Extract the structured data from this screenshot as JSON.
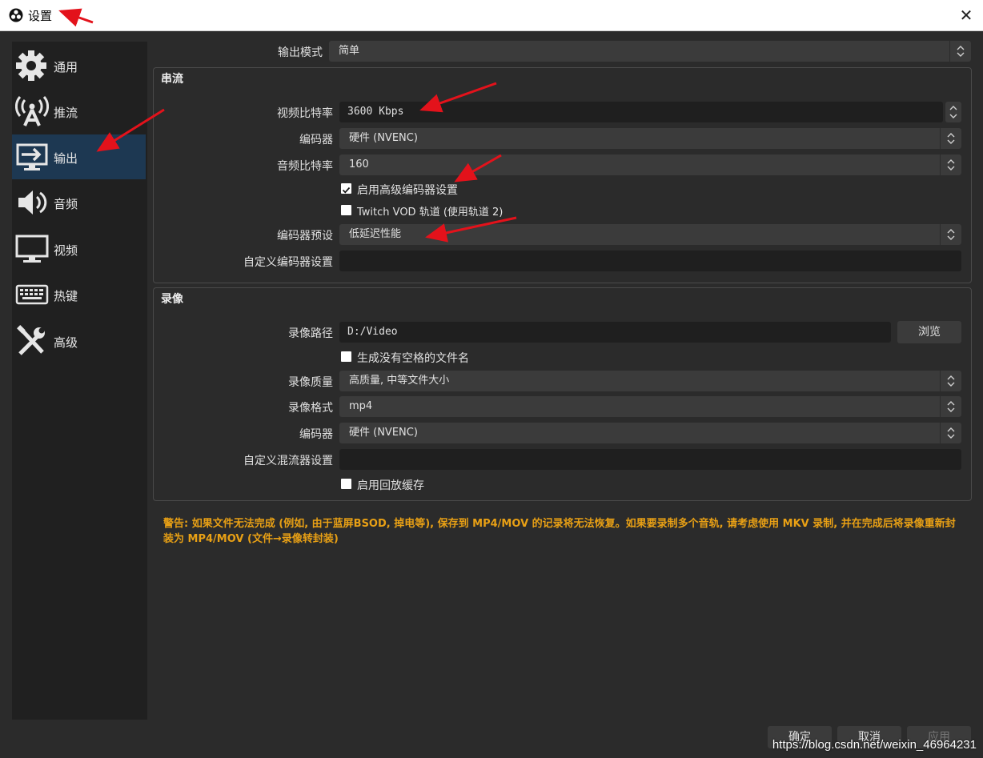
{
  "window": {
    "title": "设置",
    "close_label": "✕"
  },
  "sidebar": {
    "items": [
      {
        "label": "通用",
        "icon": "gear-icon"
      },
      {
        "label": "推流",
        "icon": "broadcast-icon"
      },
      {
        "label": "输出",
        "icon": "output-icon",
        "active": true
      },
      {
        "label": "音频",
        "icon": "speaker-icon"
      },
      {
        "label": "视频",
        "icon": "monitor-icon"
      },
      {
        "label": "热键",
        "icon": "keyboard-icon"
      },
      {
        "label": "高级",
        "icon": "tools-icon"
      }
    ]
  },
  "output_mode": {
    "label": "输出模式",
    "value": "简单"
  },
  "streaming": {
    "title": "串流",
    "video_bitrate": {
      "label": "视频比特率",
      "value": "3600 Kbps"
    },
    "encoder": {
      "label": "编码器",
      "value": "硬件 (NVENC)"
    },
    "audio_bitrate": {
      "label": "音频比特率",
      "value": "160"
    },
    "advanced_encoder": {
      "label": "启用高级编码器设置",
      "checked": true
    },
    "twitch_vod": {
      "label": "Twitch VOD 轨道 (使用轨道 2)",
      "checked": false
    },
    "encoder_preset": {
      "label": "编码器预设",
      "value": "低延迟性能"
    },
    "custom_encoder": {
      "label": "自定义编码器设置",
      "value": ""
    }
  },
  "recording": {
    "title": "录像",
    "path": {
      "label": "录像路径",
      "value": "D:/Video",
      "browse_label": "浏览"
    },
    "no_space_filename": {
      "label": "生成没有空格的文件名",
      "checked": false
    },
    "quality": {
      "label": "录像质量",
      "value": "高质量, 中等文件大小"
    },
    "format": {
      "label": "录像格式",
      "value": "mp4"
    },
    "encoder": {
      "label": "编码器",
      "value": "硬件 (NVENC)"
    },
    "custom_muxer": {
      "label": "自定义混流器设置",
      "value": ""
    },
    "replay_buffer": {
      "label": "启用回放缓存",
      "checked": false
    }
  },
  "warning": "警告: 如果文件无法完成 (例如, 由于蓝屏BSOD, 掉电等), 保存到 MP4/MOV 的记录将无法恢复。如果要录制多个音轨, 请考虑使用 MKV 录制, 并在完成后将录像重新封装为 MP4/MOV (文件→录像转封装)",
  "footer": {
    "ok_label": "确定",
    "cancel_label": "取消",
    "apply_label": "应用"
  },
  "watermark": "https://blog.csdn.net/weixin_46964231",
  "colors": {
    "background": "#2b2b2b",
    "sidebar": "#202020",
    "active": "#1d3852",
    "warning": "#e8a015",
    "annotation_arrow": "#e3121b"
  }
}
